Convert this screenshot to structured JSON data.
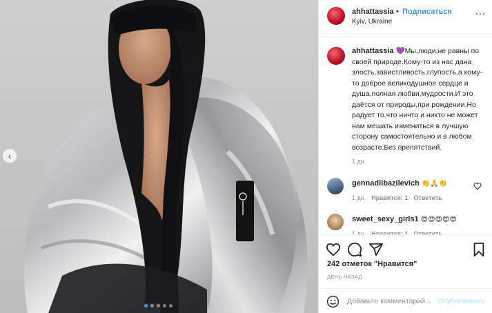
{
  "photo": {
    "prev_icon": "chevron-left-icon",
    "dots_count": 5,
    "active_dot": 0
  },
  "header": {
    "username": "ahhattassia",
    "separator": "•",
    "follow_label": "Подписаться",
    "location": "Kyiv, Ukraine",
    "more_icon": "…"
  },
  "post": {
    "username": "ahhattassia",
    "caption": "💜Мы,люди,не равны по своей природе.Кому-то из нас дана злость,завистливость,глупость,а кому-то доброе великодушное сердце и душа,полная любви,мудрости.И это даётся от природы,при рождении.Но радует то,что ничто и никто не может нам мешать измениться в лучшую сторону самостоятельно и в любом возрасте.Без препятствий.",
    "time": "1 дн."
  },
  "comments": [
    {
      "username": "gennadiibazilevich",
      "text": "👏🙏👏",
      "time": "1 дн.",
      "likes": "Нравится: 1",
      "reply": "Ответить"
    },
    {
      "username": "sweet_sexy_girls1",
      "text": "😍😍😍😍😍",
      "time": "1 дн.",
      "likes": "Нравится: 1",
      "reply": "Ответить"
    }
  ],
  "likes": {
    "count": "242",
    "label": "отметок \"Нравится\""
  },
  "age": "ДЕНЬ НАЗАД",
  "add_comment": {
    "placeholder": "Добавьте комментарий...",
    "publish_label": "Опубликовать"
  },
  "colors": {
    "accent": "#3897f0",
    "publish_disabled": "#b2dffc",
    "muted": "#8e8e8e"
  }
}
